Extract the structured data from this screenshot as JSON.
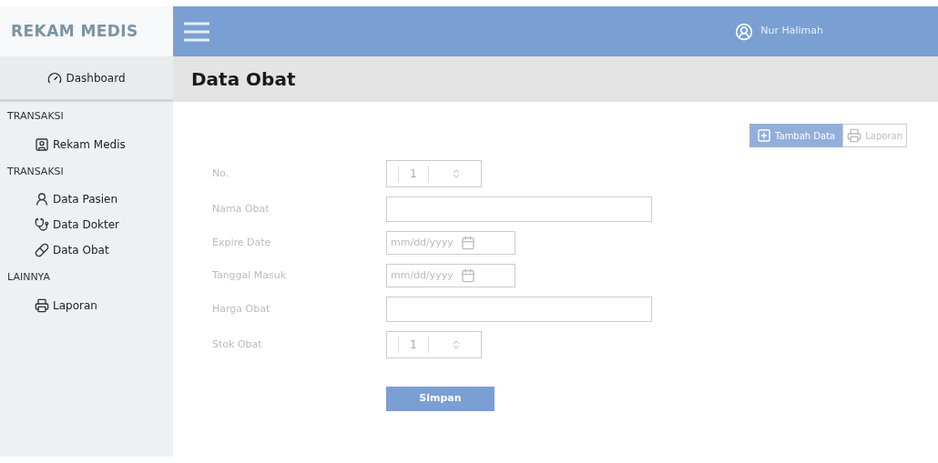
{
  "sidebar": {
    "brand": "REKAM MEDIS",
    "dashboard": "Dashboard",
    "sections": [
      {
        "title": "TRANSAKSI",
        "items": [
          {
            "label": "Rekam Medis",
            "kind": "record"
          }
        ]
      },
      {
        "title": "TRANSAKSI",
        "items": [
          {
            "label": "Data Pasien",
            "kind": "patient"
          },
          {
            "label": "Data Dokter",
            "kind": "doctor"
          },
          {
            "label": "Data Obat",
            "kind": "medicine"
          }
        ]
      },
      {
        "title": "LAINNYA",
        "items": [
          {
            "label": "Laporan",
            "kind": "report"
          }
        ]
      }
    ]
  },
  "topbar": {
    "user": "Nur Halimah"
  },
  "page": {
    "title": "Data Obat",
    "actions": [
      {
        "label": "Tambah Data",
        "kind": "primary"
      },
      {
        "label": "Laporan",
        "kind": "outline"
      }
    ],
    "fields": [
      {
        "label": "No.",
        "kind": "number",
        "value": "1"
      },
      {
        "label": "Nama Obat",
        "kind": "text"
      },
      {
        "label": "Expire Date",
        "kind": "date",
        "placeholder": "mm/dd/yyyy"
      },
      {
        "label": "Tanggal Masuk",
        "kind": "date",
        "placeholder": "mm/dd/yyyy"
      },
      {
        "label": "Harga Obat",
        "kind": "text"
      },
      {
        "label": "Stok Obat",
        "kind": "number",
        "value": "1"
      }
    ],
    "submit": "Simpan"
  }
}
